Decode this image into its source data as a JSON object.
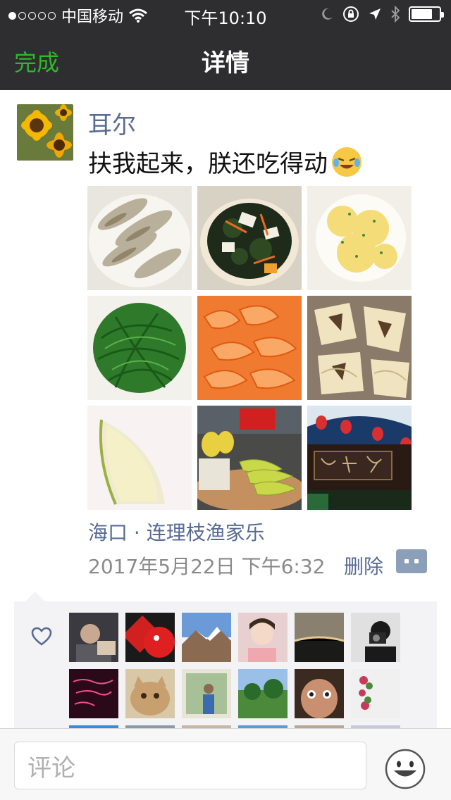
{
  "status_bar": {
    "carrier": "中国移动",
    "time": "下午10:10",
    "signal_dots_filled": 1,
    "signal_dots_total": 5,
    "battery_level": 0.75,
    "icons": [
      "wifi-icon",
      "moon-icon",
      "rotation-lock-icon",
      "location-arrow-icon",
      "bluetooth-icon",
      "battery-icon"
    ]
  },
  "nav": {
    "done_label": "完成",
    "title": "详情"
  },
  "post": {
    "username": "耳尔",
    "text": "扶我起来，朕还吃得动",
    "emoji": "laughing-crying-emoji",
    "photos": [
      "steamed-fish-photo",
      "seaweed-salad-photo",
      "scrambled-eggs-photo",
      "stir-fried-greens-photo",
      "boiled-shrimp-photo",
      "chopped-chicken-photo",
      "fruit-slice-photo",
      "bananas-market-photo",
      "restaurant-sign-photo"
    ],
    "location": "海口 · 连理枝渔家乐",
    "timestamp": "2017年5月22日 下午6:32",
    "delete_label": "删除"
  },
  "likes": {
    "icon": "heart-icon",
    "avatars": [
      "liker-avatar-1",
      "liker-avatar-2",
      "liker-avatar-3",
      "liker-avatar-4",
      "liker-avatar-5",
      "liker-avatar-6",
      "liker-avatar-7",
      "liker-avatar-8",
      "liker-avatar-9",
      "liker-avatar-10",
      "liker-avatar-11",
      "liker-avatar-12"
    ]
  },
  "comment_bar": {
    "placeholder": "评论",
    "emoji_button": "smiley-icon"
  },
  "colors": {
    "nav_bg": "#2e2e30",
    "done_green": "#2eb82e",
    "link_blue": "#576b95",
    "meta_gray": "#8a8a8a",
    "likes_bg": "#f3f3f5"
  }
}
